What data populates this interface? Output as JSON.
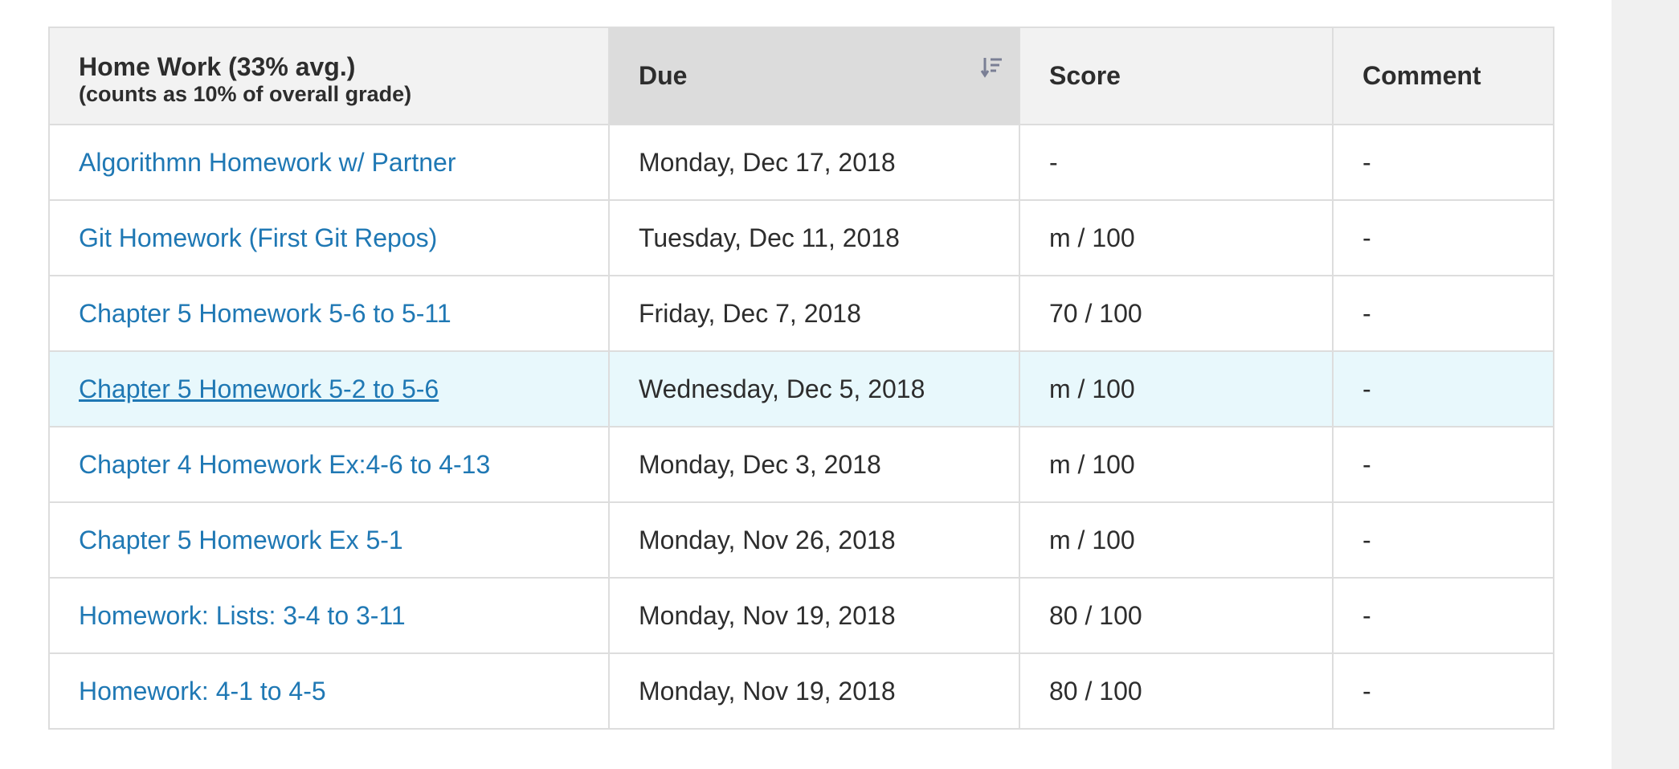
{
  "table": {
    "headers": {
      "title": "Home Work (33% avg.)",
      "subtitle": "(counts as 10% of overall grade)",
      "due": "Due",
      "score": "Score",
      "comment": "Comment",
      "sort_icon": "sort-descending-icon"
    },
    "rows": [
      {
        "name": "Algorithmn Homework w/ Partner",
        "due": "Monday, Dec 17, 2018",
        "score": "-",
        "comment": "-"
      },
      {
        "name": "Git Homework (First Git Repos)",
        "due": "Tuesday, Dec 11, 2018",
        "score": "m / 100",
        "comment": "-"
      },
      {
        "name": "Chapter 5 Homework 5-6 to 5-11",
        "due": "Friday, Dec 7, 2018",
        "score": "70 / 100",
        "comment": "-"
      },
      {
        "name": "Chapter 5 Homework 5-2 to 5-6",
        "due": "Wednesday, Dec 5, 2018",
        "score": "m / 100",
        "comment": "-"
      },
      {
        "name": "Chapter 4 Homework Ex:4-6 to 4-13",
        "due": "Monday, Dec 3, 2018",
        "score": "m / 100",
        "comment": "-"
      },
      {
        "name": "Chapter 5 Homework Ex 5-1",
        "due": "Monday, Nov 26, 2018",
        "score": "m / 100",
        "comment": "-"
      },
      {
        "name": "Homework: Lists: 3-4 to 3-11",
        "due": "Monday, Nov 19, 2018",
        "score": "80 / 100",
        "comment": "-"
      },
      {
        "name": "Homework: 4-1 to 4-5",
        "due": "Monday, Nov 19, 2018",
        "score": "80 / 100",
        "comment": "-"
      }
    ]
  },
  "colors": {
    "link": "#1f78b4",
    "highlight_row": "#e8f8fc",
    "header_bg": "#f2f2f2",
    "sorted_header_bg": "#dcdcdc"
  }
}
